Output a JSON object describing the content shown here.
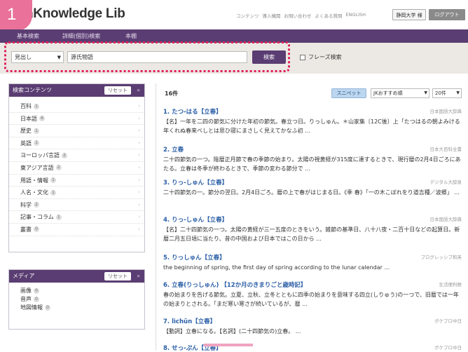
{
  "step_badge": "1",
  "header": {
    "logo": "JapanKnowledge Lib",
    "logo_visible": "nKnowledge Lib",
    "links": [
      "コンテンツ",
      "導入機関",
      "お問い合わせ",
      "よくある質問",
      "ENGLISH"
    ],
    "university": "静岡大学 様",
    "logout": "ログアウト"
  },
  "nav": {
    "tabs": [
      "基本検索",
      "詳細(個別)検索",
      "本棚"
    ]
  },
  "search": {
    "scope": "見出し",
    "query": "源氏物語",
    "button": "検索",
    "phrase_label": "フレーズ検索"
  },
  "content_panel": {
    "title": "検索コンテンツ",
    "reset": "リセット",
    "items": [
      {
        "label": "百科",
        "count": "1"
      },
      {
        "label": "日本語",
        "count": "6"
      },
      {
        "label": "歴史",
        "count": "1"
      },
      {
        "label": "英語",
        "count": "1"
      },
      {
        "label": "ヨーロッパ言語",
        "count": "2"
      },
      {
        "label": "東アジア言語",
        "count": "2"
      },
      {
        "label": "用語・情報",
        "count": "1"
      },
      {
        "label": "人名・文化",
        "count": "1"
      },
      {
        "label": "科学",
        "count": "2"
      },
      {
        "label": "記事・コラム",
        "count": "1"
      },
      {
        "label": "叢書",
        "count": "0"
      }
    ]
  },
  "media_panel": {
    "title": "メディア",
    "reset": "リセット",
    "items": [
      {
        "label": "画像",
        "count": "0"
      },
      {
        "label": "音声",
        "count": "0"
      },
      {
        "label": "地図情報",
        "count": "0"
      }
    ]
  },
  "results": {
    "count": "16件",
    "snippet": "スニペット",
    "sort": "JKおすすめ順",
    "per_page": "20件",
    "entries": [
      {
        "title": "1. たつ-はる【立春】",
        "source": "日本国語大辞典",
        "body": "【名】一年を二四の節気に分けた年初の節気。春立つ日。りっしゅん。＊山家集〔12C後〕上「たつはるの朝よみける 年くれぬ春来べしとは思ひ寝にまさしく見えてかなふ初 ..."
      },
      {
        "title": "2. 立春",
        "source": "日本大百科全書",
        "body": "二十四節気の一つ。陰暦正月節で春の季節の始まり。太陽の視黄経が315度に達するときで、現行暦の2月4日ごろにあたる。立春は冬季が終わるときで、季節の変わる節分で ..."
      },
      {
        "title": "3. りっ-しゅん【立春】",
        "source": "デジタル大辞泉",
        "body": "二十四節気の一。節分の翌日。2月4日ごろ。暦の上で春がはじまる日。《季 春》「一の木こぼれをり道吉種／波郷」 ..."
      },
      {
        "title": "4. りっ-しゅん【立春】",
        "source": "日本国語大辞典",
        "body": "【名】二十四節気の一つ。太陽の黄経が三一五度のときをいう。雑節の基準日、八十八夜・二百十日などの起算日。新暦二月五日頃に当たり、昔の中国および日本ではこの日から ..."
      },
      {
        "title": "5. りっしゅん【立春】",
        "source": "プログレッシブ和英",
        "body": "the beginning of spring, the first day of spring according to the lunar calendar ..."
      },
      {
        "title": "6. 立春(りっしゅん) 【12か月のきまりごと歳時記】",
        "source": "生活便利帳",
        "body": "春の始まりを告げる節気。立夏、立秋、立冬とともに四季の始まりを意味する四立(しりゅう)の一つで、旧暦では一年の始まりとされる。「まだ寒い寒さが続いているが、暦 ..."
      },
      {
        "title": "7. lìchūn【立春】",
        "source": "ポケプロ中日",
        "body": "【動詞】立春になる。【名詞】(二十四節気の)立春。 ..."
      },
      {
        "title": "8. せっ-ぷん【立春】",
        "source": "ポケプロ中日",
        "body": ""
      }
    ]
  }
}
